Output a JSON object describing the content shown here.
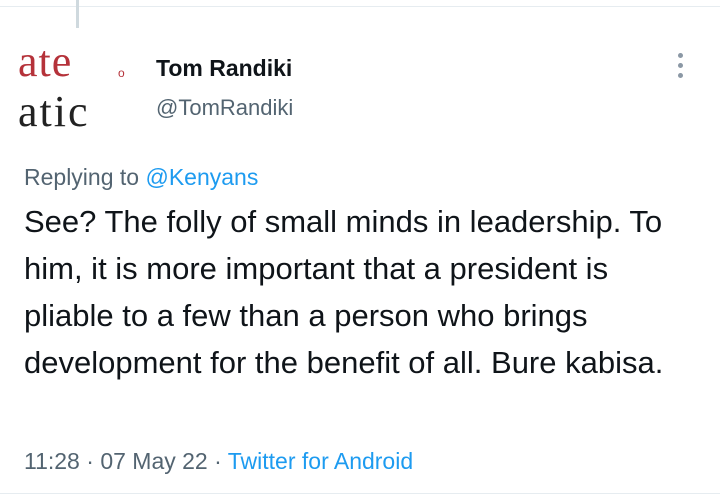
{
  "tweet": {
    "display_name": "Tom Randiki",
    "handle": "@TomRandiki",
    "avatar_text_line1": "ate",
    "avatar_text_line2": "atic",
    "replying_prefix": "Replying to",
    "replying_to": "@Kenyans",
    "text": "See? The folly of small minds in leadership. To him, it is more important that a president is pliable to a few than a person who brings development for the benefit of all. Bure kabisa.",
    "time": "11:28",
    "date": "07 May 22",
    "source": "Twitter for Android",
    "separator": "·"
  },
  "icons": {
    "more": "more-vertical-icon"
  },
  "colors": {
    "accent": "#1d9bf0",
    "secondary_text": "#536471",
    "avatar_red": "#b5323a"
  }
}
